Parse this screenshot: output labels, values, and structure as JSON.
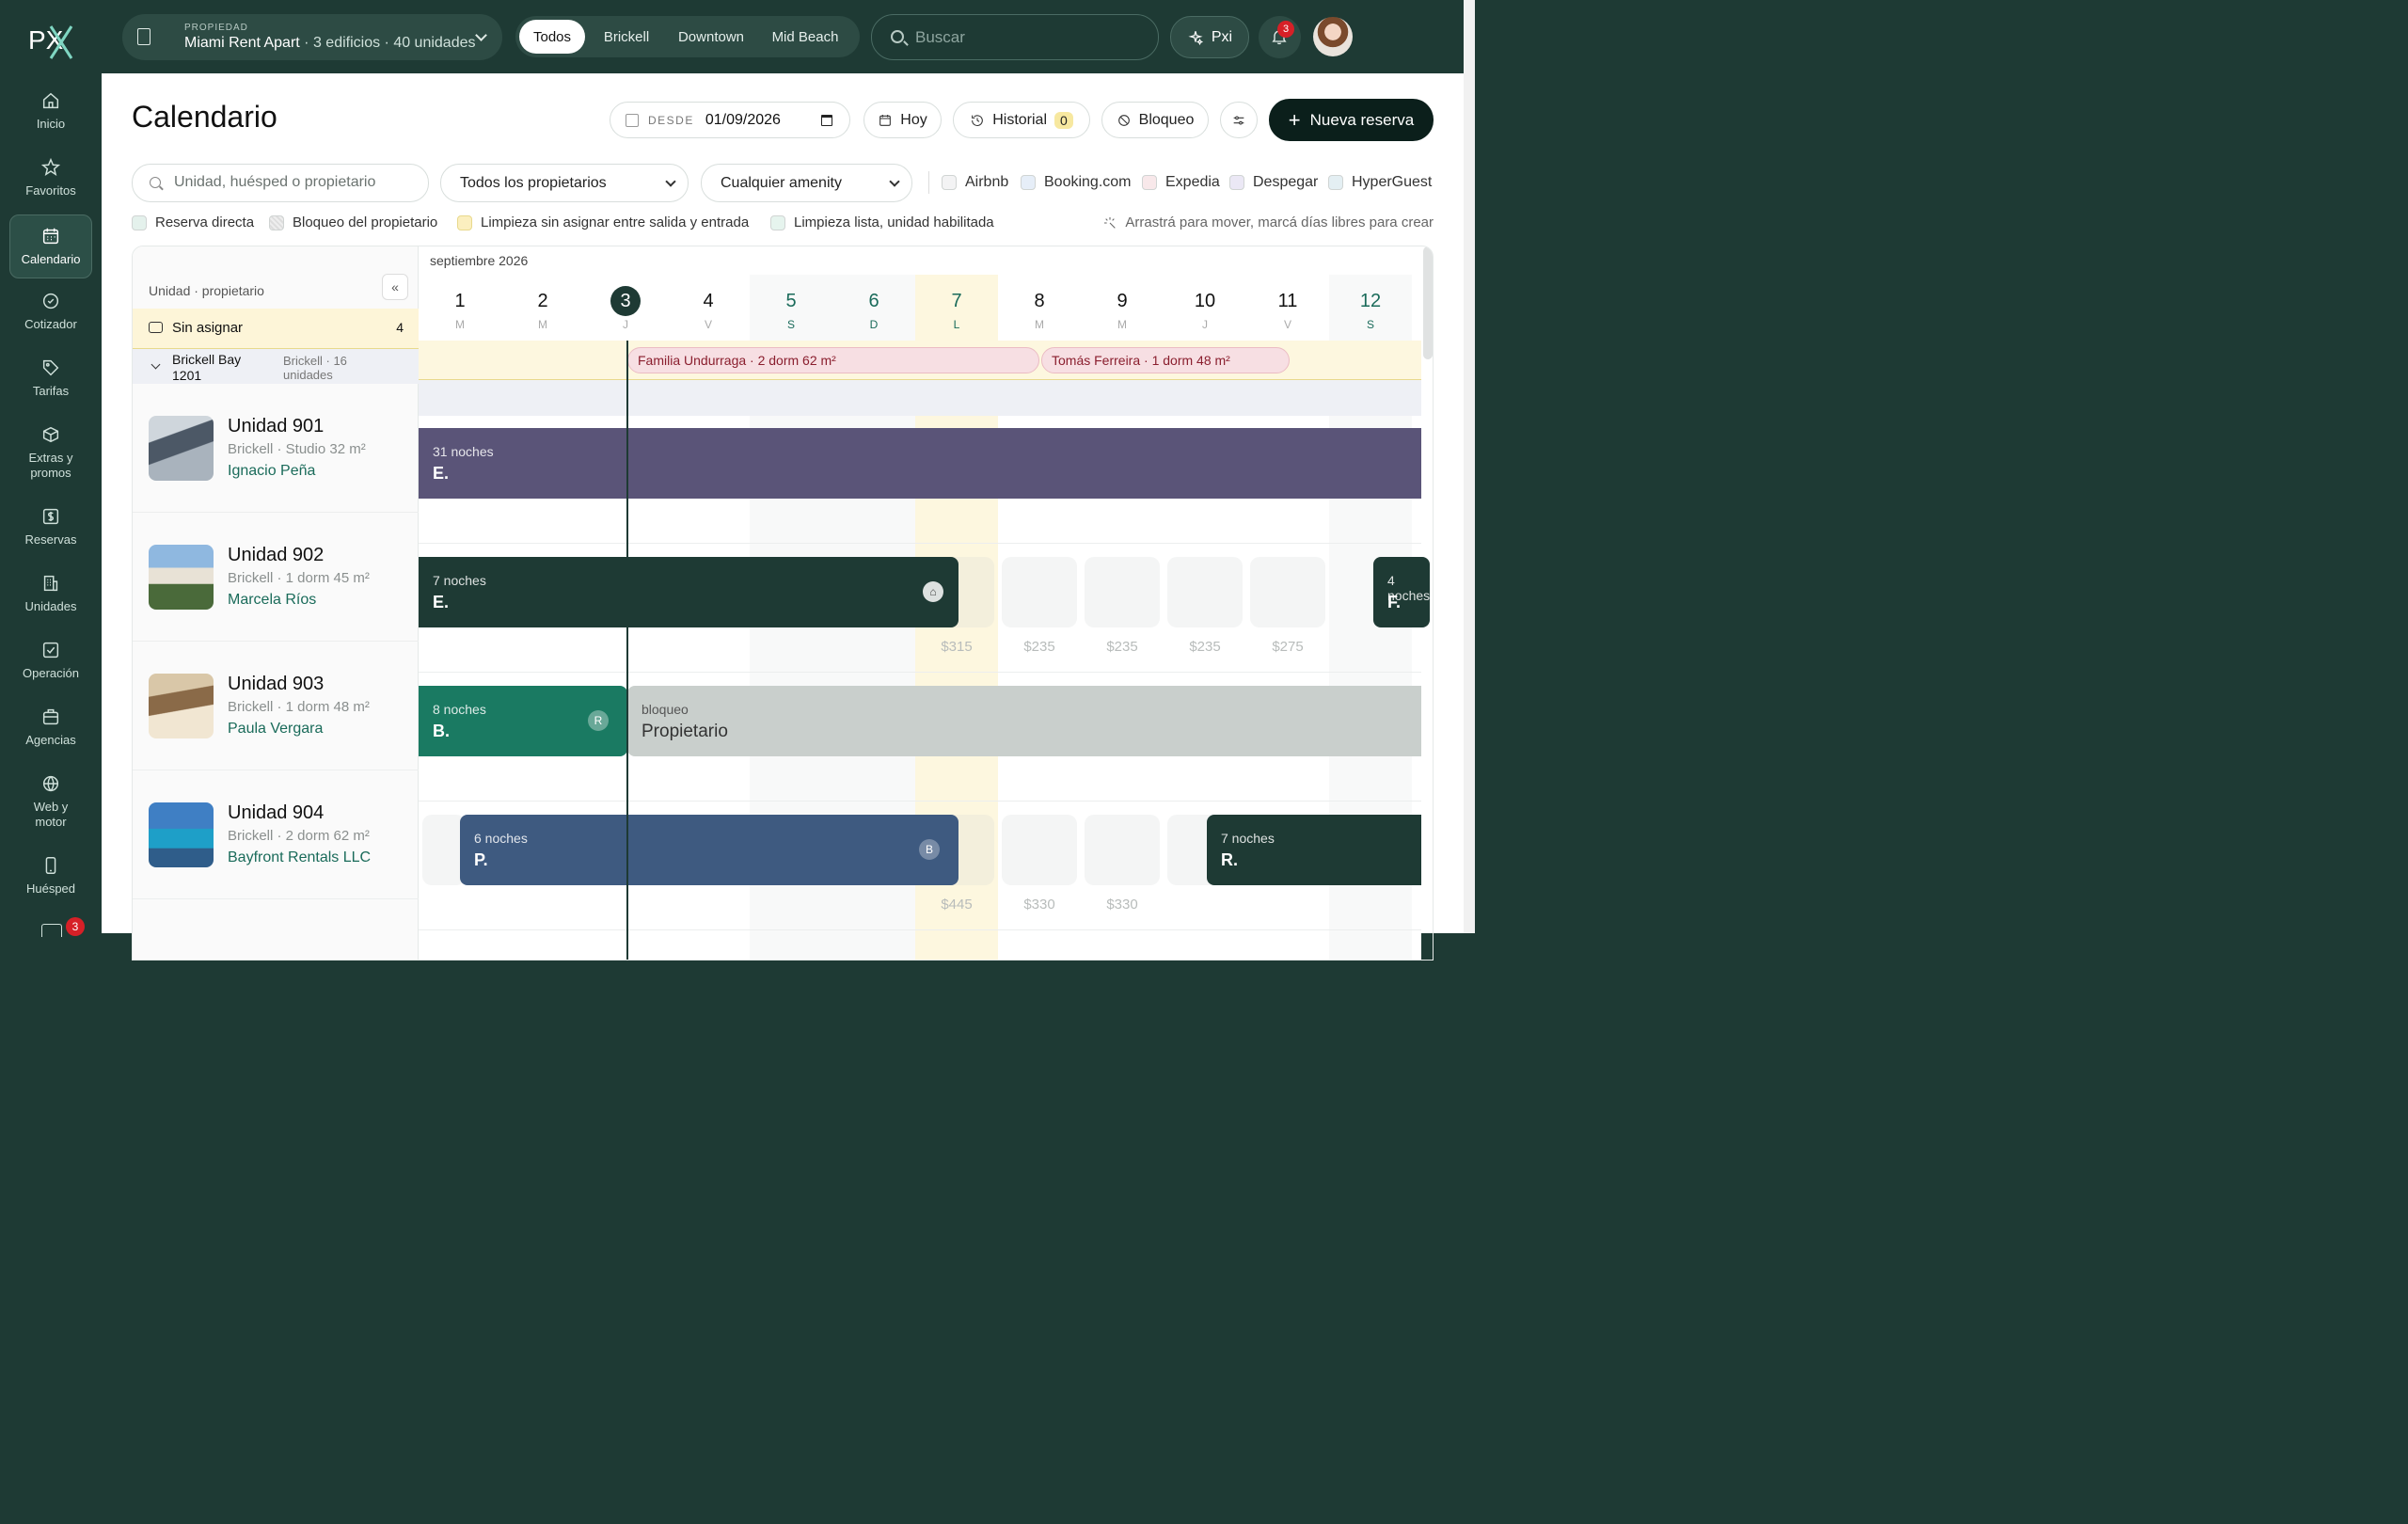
{
  "sidebar": {
    "logo": "PX",
    "items": [
      {
        "label": "Inicio",
        "icon": "home-icon"
      },
      {
        "label": "Favoritos",
        "icon": "star-icon"
      },
      {
        "label": "Calendario",
        "icon": "calendar-icon"
      },
      {
        "label": "Cotizador",
        "icon": "quote-icon"
      },
      {
        "label": "Tarifas",
        "icon": "tag-icon"
      },
      {
        "label": "Extras y promos",
        "icon": "box-icon"
      },
      {
        "label": "Reservas",
        "icon": "dollar-icon"
      },
      {
        "label": "Unidades",
        "icon": "building-icon"
      },
      {
        "label": "Operación",
        "icon": "checklist-icon"
      },
      {
        "label": "Agencias",
        "icon": "briefcase-icon"
      },
      {
        "label": "Web y motor",
        "icon": "globe-icon"
      },
      {
        "label": "Huésped",
        "icon": "phone-icon"
      }
    ],
    "bottom_badge": "3"
  },
  "topbar": {
    "property_kicker": "PROPIEDAD",
    "property_name": "Miami Rent Apart",
    "property_sub": "· 3 edificios · 40 unidades",
    "filters": [
      "Todos",
      "Brickell",
      "Downtown",
      "Mid Beach"
    ],
    "active_filter": "Todos",
    "search_placeholder": "Buscar",
    "pxi_label": "Pxi",
    "notif_count": "3"
  },
  "header": {
    "title": "Calendario",
    "date_label": "DESDE",
    "date_value": "01/09/2026",
    "today_btn": "Hoy",
    "history_btn": "Historial",
    "history_count": "0",
    "block_btn": "Bloqueo",
    "new_btn": "Nueva reserva"
  },
  "filters": {
    "search_placeholder": "Unidad, huésped o propietario",
    "owner_select": "Todos los propietarios",
    "amenity_select": "Cualquier amenity",
    "channels": [
      {
        "label": "Airbnb",
        "color": "#f3f3f4"
      },
      {
        "label": "Booking.com",
        "color": "#e6eef8"
      },
      {
        "label": "Expedia",
        "color": "#f8e8ea"
      },
      {
        "label": "Despegar",
        "color": "#ebe8f5"
      },
      {
        "label": "HyperGuest",
        "color": "#e4eff3"
      }
    ],
    "legend": [
      {
        "label": "Reserva directa",
        "color": "#e4f1ec"
      },
      {
        "label": "Bloqueo del propietario",
        "color": "#eceeee"
      },
      {
        "label": "Limpieza sin asignar entre salida y entrada",
        "color": "#fbefbf"
      },
      {
        "label": "Limpieza lista, unidad habilitada",
        "color": "#e6f4ee"
      }
    ],
    "hint": "Arrastrá para mover, marcá días libres para crear"
  },
  "calendar": {
    "column_header": "Unidad · propietario",
    "unassigned_label": "Sin asignar",
    "unassigned_count": "4",
    "building": {
      "name": "Brickell Bay 1201",
      "meta": "Brickell · 16 unidades"
    },
    "month": "septiembre 2026",
    "days": [
      {
        "num": "1",
        "wd": "M"
      },
      {
        "num": "2",
        "wd": "M"
      },
      {
        "num": "3",
        "wd": "J"
      },
      {
        "num": "4",
        "wd": "V"
      },
      {
        "num": "5",
        "wd": "S"
      },
      {
        "num": "6",
        "wd": "D"
      },
      {
        "num": "7",
        "wd": "L"
      },
      {
        "num": "8",
        "wd": "M"
      },
      {
        "num": "9",
        "wd": "M"
      },
      {
        "num": "10",
        "wd": "J"
      },
      {
        "num": "11",
        "wd": "V"
      },
      {
        "num": "12",
        "wd": "S"
      }
    ],
    "today_index": 2,
    "unassigned_chips": [
      "Familia Undurraga · 2 dorm 62 m²",
      "Tomás Ferreira · 1 dorm 48 m²"
    ],
    "units": [
      {
        "name": "Unidad 901",
        "meta": "Brickell · Studio 32 m²",
        "owner": "Ignacio Peña",
        "bars": [
          {
            "nights": "31 noches",
            "guest": "E.",
            "color": "#5a5478"
          }
        ]
      },
      {
        "name": "Unidad 902",
        "meta": "Brickell · 1 dorm 45 m²",
        "owner": "Marcela Ríos",
        "bars": [
          {
            "nights": "7 noches",
            "guest": "E.",
            "color": "#1e3a34"
          },
          {
            "nights": "4 noches",
            "guest": "F.",
            "color": "#1e3a34"
          }
        ],
        "prices": [
          "$315",
          "$235",
          "$235",
          "$235",
          "$275"
        ]
      },
      {
        "name": "Unidad 903",
        "meta": "Brickell · 1 dorm 48 m²",
        "owner": "Paula Vergara",
        "bars": [
          {
            "nights": "8 noches",
            "guest": "B.",
            "badge": "R",
            "color": "#1a7a62"
          },
          {
            "nights": "bloqueo",
            "guest": "Propietario",
            "color": "#c9cfcc"
          }
        ]
      },
      {
        "name": "Unidad 904",
        "meta": "Brickell · 2 dorm 62 m²",
        "owner": "Bayfront Rentals LLC",
        "bars": [
          {
            "nights": "6 noches",
            "guest": "P.",
            "badge": "B",
            "color": "#3e5a80"
          },
          {
            "nights": "7 noches",
            "guest": "R.",
            "color": "#1e3a34"
          }
        ],
        "prices": [
          "$445",
          "$330",
          "$330"
        ]
      }
    ]
  }
}
